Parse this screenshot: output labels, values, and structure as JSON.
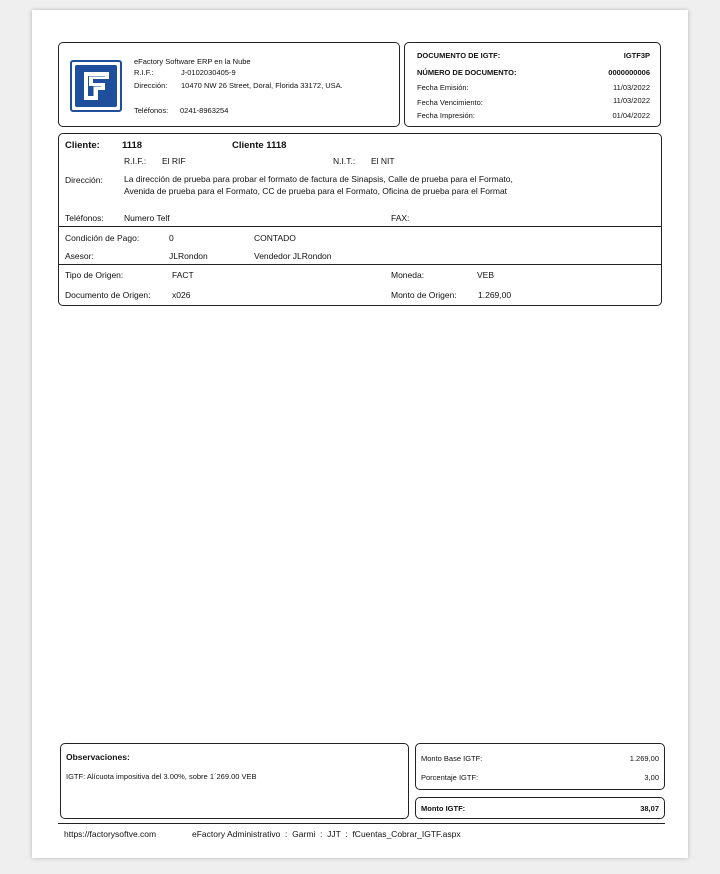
{
  "company": {
    "name": "eFactory Software ERP en la Nube",
    "rif_label": "R.I.F.:",
    "rif": "J-0102030405-9",
    "address_label": "Dirección:",
    "address": "10470 NW 26 Street, Doral, Florida 33172, USA.",
    "phones_label": "Teléfonos:",
    "phones": "0241-8963254"
  },
  "document": {
    "title_label": "DOCUMENTO DE IGTF:",
    "title_value": "IGTF3P",
    "number_label": "NÚMERO DE DOCUMENTO:",
    "number_value": "0000000006",
    "issue_label": "Fecha Emisión:",
    "issue_value": "11/03/2022",
    "due_label": "Fecha Vencimiento:",
    "due_value": "11/03/2022",
    "print_label": "Fecha Impresión:",
    "print_value": "01/04/2022"
  },
  "client": {
    "label": "Cliente:",
    "code": "1118",
    "name": "Cliente 1118",
    "rif_label": "R.I.F.:",
    "rif": "El RIF",
    "nit_label": "N.I.T.:",
    "nit": "El NIT",
    "address_label": "Dirección:",
    "address_line1": "La dirección de prueba para probar el formato de factura de Sinapsis, Calle de prueba para el Formato,",
    "address_line2": "Avenida de prueba para el Formato, CC de prueba para el Formato, Oficina de prueba para el Format",
    "phones_label": "Teléfonos:",
    "phones": "Numero Telf",
    "fax_label": "FAX:",
    "fax": ""
  },
  "terms": {
    "payment_label": "Condición de Pago:",
    "payment_code": "0",
    "payment_name": "CONTADO",
    "advisor_label": "Asesor:",
    "advisor_code": "JLRondon",
    "advisor_name": "Vendedor JLRondon"
  },
  "origin": {
    "type_label": "Tipo de Origen:",
    "type": "FACT",
    "currency_label": "Moneda:",
    "currency": "VEB",
    "doc_label": "Documento de Origen:",
    "doc": "x026",
    "amount_label": "Monto de Origen:",
    "amount": "1.269,00"
  },
  "observations": {
    "label": "Observaciones:",
    "text": "IGTF: Alícuota impositiva del 3.00%, sobre 1´269.00 VEB"
  },
  "totals": {
    "base_label": "Monto Base IGTF:",
    "base": "1.269,00",
    "pct_label": "Porcentaje IGTF:",
    "pct": "3,00",
    "total_label": "Monto IGTF:",
    "total": "38,07"
  },
  "footer": {
    "url": "https://factorysoftve.com",
    "info": "eFactory Administrativo  :  Garmi  :  JJT  :  fCuentas_Cobrar_IGTF.aspx"
  },
  "colors": {
    "logo_blue": "#1e4e9c",
    "border": "#222222"
  }
}
